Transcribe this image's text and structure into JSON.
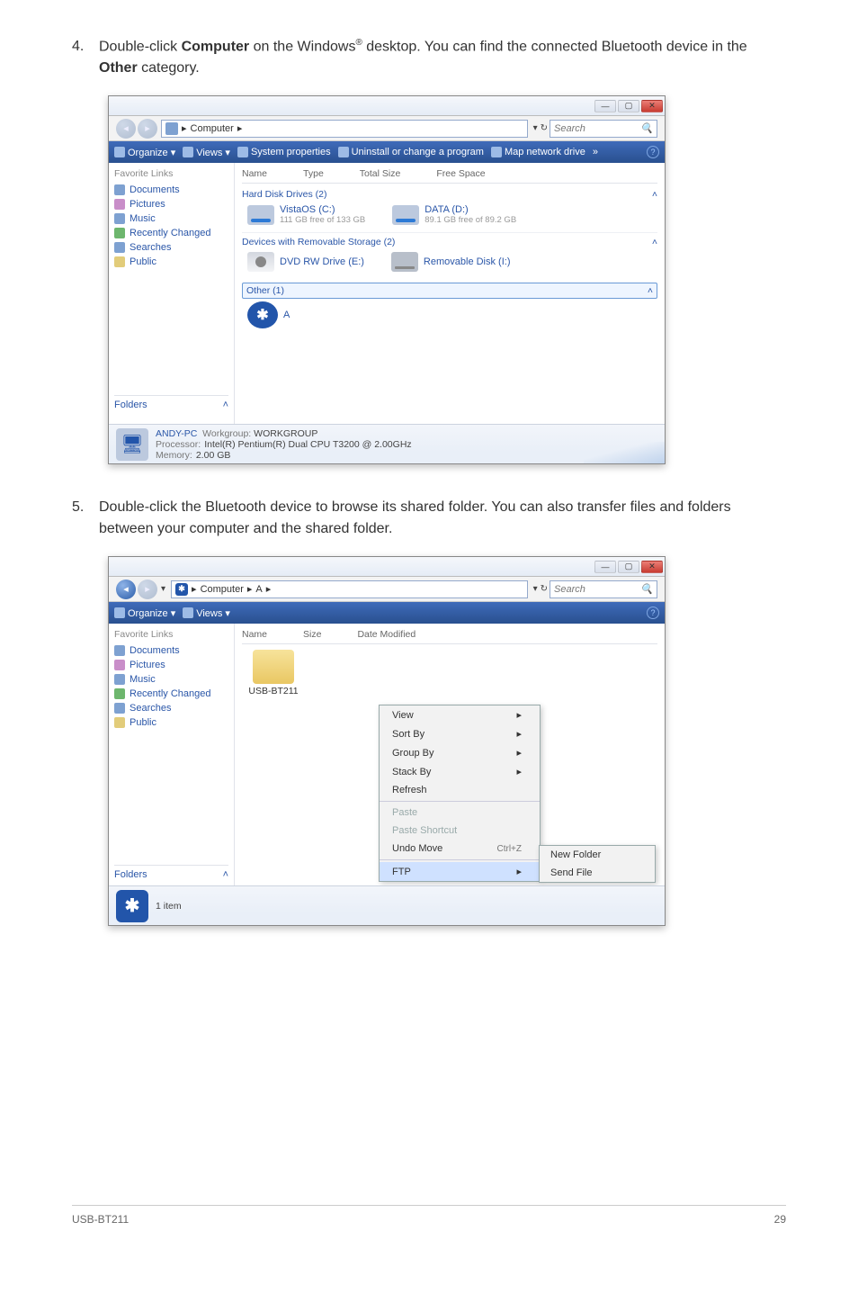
{
  "step4": {
    "num": "4.",
    "pre": "Double-click ",
    "comp": "Computer",
    "mid": " on the Windows",
    "reg": "®",
    "mid2": " desktop. You can find the connected Bluetooth device in the ",
    "other": "Other",
    "post": " category."
  },
  "win1": {
    "crumb_comp": "Computer",
    "crumb_arrow": "▸",
    "search_dd": "▾",
    "search_refresh": "↻",
    "search_placeholder": "Search",
    "toolbar": {
      "organize": "Organize ▾",
      "views": "Views ▾",
      "sysprops": "System properties",
      "uninstall": "Uninstall or change a program",
      "mapdrive": "Map network drive",
      "more": "»",
      "help": "?"
    },
    "favs_hdr": "Favorite Links",
    "favs": [
      "Documents",
      "Pictures",
      "Music",
      "Recently Changed",
      "Searches",
      "Public"
    ],
    "folders_label": "Folders",
    "folders_caret": "˄",
    "cols": [
      "Name",
      "Type",
      "Total Size",
      "Free Space"
    ],
    "group_hdd": "Hard Disk Drives (2)",
    "group_hdd_caret": "˄",
    "drive_c_name": "VistaOS (C:)",
    "drive_c_free": "111 GB free of 133 GB",
    "drive_d_name": "DATA (D:)",
    "drive_d_free": "89.1 GB free of 89.2 GB",
    "group_rem": "Devices with Removable Storage (2)",
    "group_rem_caret": "˄",
    "drive_e": "DVD RW Drive (E:)",
    "drive_i": "Removable Disk (I:)",
    "group_other": "Other (1)",
    "group_other_caret": "˄",
    "bt_glyph": "✱",
    "bt_name": "A",
    "status": {
      "name": "ANDY-PC",
      "workgroup_k": "Workgroup:",
      "workgroup_v": "WORKGROUP",
      "proc_k": "Processor:",
      "proc_v": "Intel(R) Pentium(R) Dual  CPU  T3200  @ 2.00GHz",
      "mem_k": "Memory:",
      "mem_v": "2.00 GB"
    }
  },
  "step5": {
    "num": "5.",
    "text": "Double-click the Bluetooth device to browse its shared folder. You can also transfer files and folders between your computer and the shared folder."
  },
  "win2": {
    "crumb_comp": "Computer",
    "crumb_a": "A",
    "crumb_arrow": "▸",
    "bt_glyph_small": "✱",
    "search_placeholder": "Search",
    "toolbar": {
      "organize": "Organize ▾",
      "views": "Views ▾",
      "help": "?"
    },
    "favs_hdr": "Favorite Links",
    "favs": [
      "Documents",
      "Pictures",
      "Music",
      "Recently Changed",
      "Searches",
      "Public"
    ],
    "folders_label": "Folders",
    "folders_caret": "˄",
    "cols": [
      "Name",
      "Size",
      "Date Modified"
    ],
    "item_name": "USB-BT211",
    "ctx": {
      "view": "View",
      "sort": "Sort By",
      "group": "Group By",
      "stack": "Stack By",
      "refresh": "Refresh",
      "paste": "Paste",
      "paste_sc": "Paste Shortcut",
      "undo": "Undo Move",
      "undo_key": "Ctrl+Z",
      "ftp": "FTP",
      "arrow": "▸"
    },
    "sub": {
      "newfolder": "New Folder",
      "sendfile": "Send File"
    },
    "status_item": "1 item"
  },
  "footer": {
    "left": "USB-BT211",
    "right": "29"
  }
}
